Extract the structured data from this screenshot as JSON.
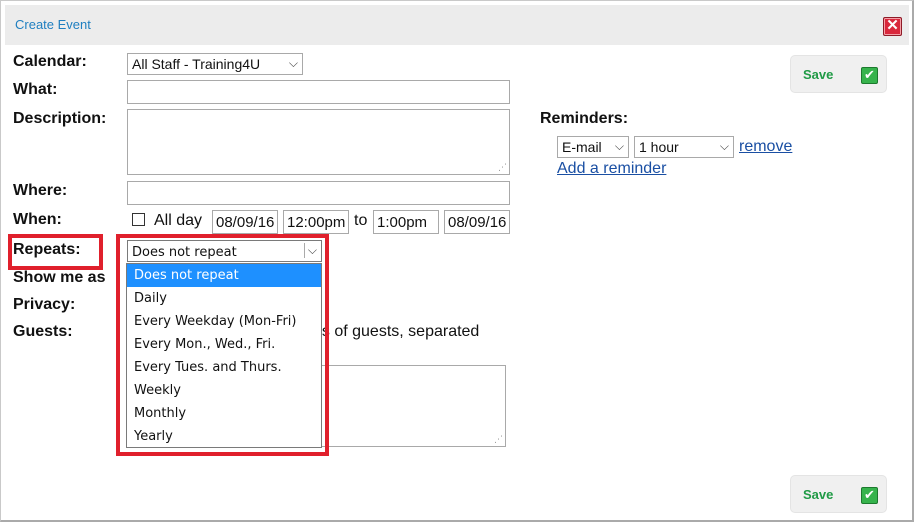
{
  "dialog": {
    "title": "Create Event",
    "close_glyph": "✕"
  },
  "form": {
    "calendar_label": "Calendar:",
    "calendar_value": "All Staff - Training4U",
    "what_label": "What:",
    "what_value": "",
    "description_label": "Description:",
    "description_value": "",
    "where_label": "Where:",
    "where_value": "",
    "when_label": "When:",
    "all_day_label": "All day",
    "all_day_checked": false,
    "start_date": "08/09/16",
    "start_time": "12:00pm",
    "to_label": "to",
    "end_time": "1:00pm",
    "end_date": "08/09/16",
    "repeats_label": "Repeats:",
    "repeats_value": "Does not repeat",
    "show_me_as_label": "Show me as",
    "privacy_label": "Privacy:",
    "guests_label": "Guests:",
    "guests_hint_partial": "es of guests, separated",
    "guests_value": ""
  },
  "reminders": {
    "label": "Reminders:",
    "method_value": "E-mail",
    "time_value": "1 hour",
    "remove_label": "remove",
    "add_label": "Add a reminder"
  },
  "repeat_options": [
    "Does not repeat",
    "Daily",
    "Every Weekday (Mon-Fri)",
    "Every Mon., Wed., Fri.",
    "Every Tues. and Thurs.",
    "Weekly",
    "Monthly",
    "Yearly"
  ],
  "repeat_selected_index": 0,
  "buttons": {
    "save_top_label": "Save",
    "save_bottom_label": "Save",
    "save_icon_glyph": "✔"
  },
  "colors": {
    "title_blue": "#1f7fc0",
    "close_red": "#d9283c",
    "save_green": "#1f9a45",
    "highlight_red": "#e0202c",
    "selected_blue": "#1e90ff",
    "link_blue": "#1a4fa3"
  },
  "icons": {
    "close": "close-icon",
    "save": "checkmark-icon",
    "dropdown": "chevron-down-icon",
    "resize": "resize-grip-icon"
  }
}
